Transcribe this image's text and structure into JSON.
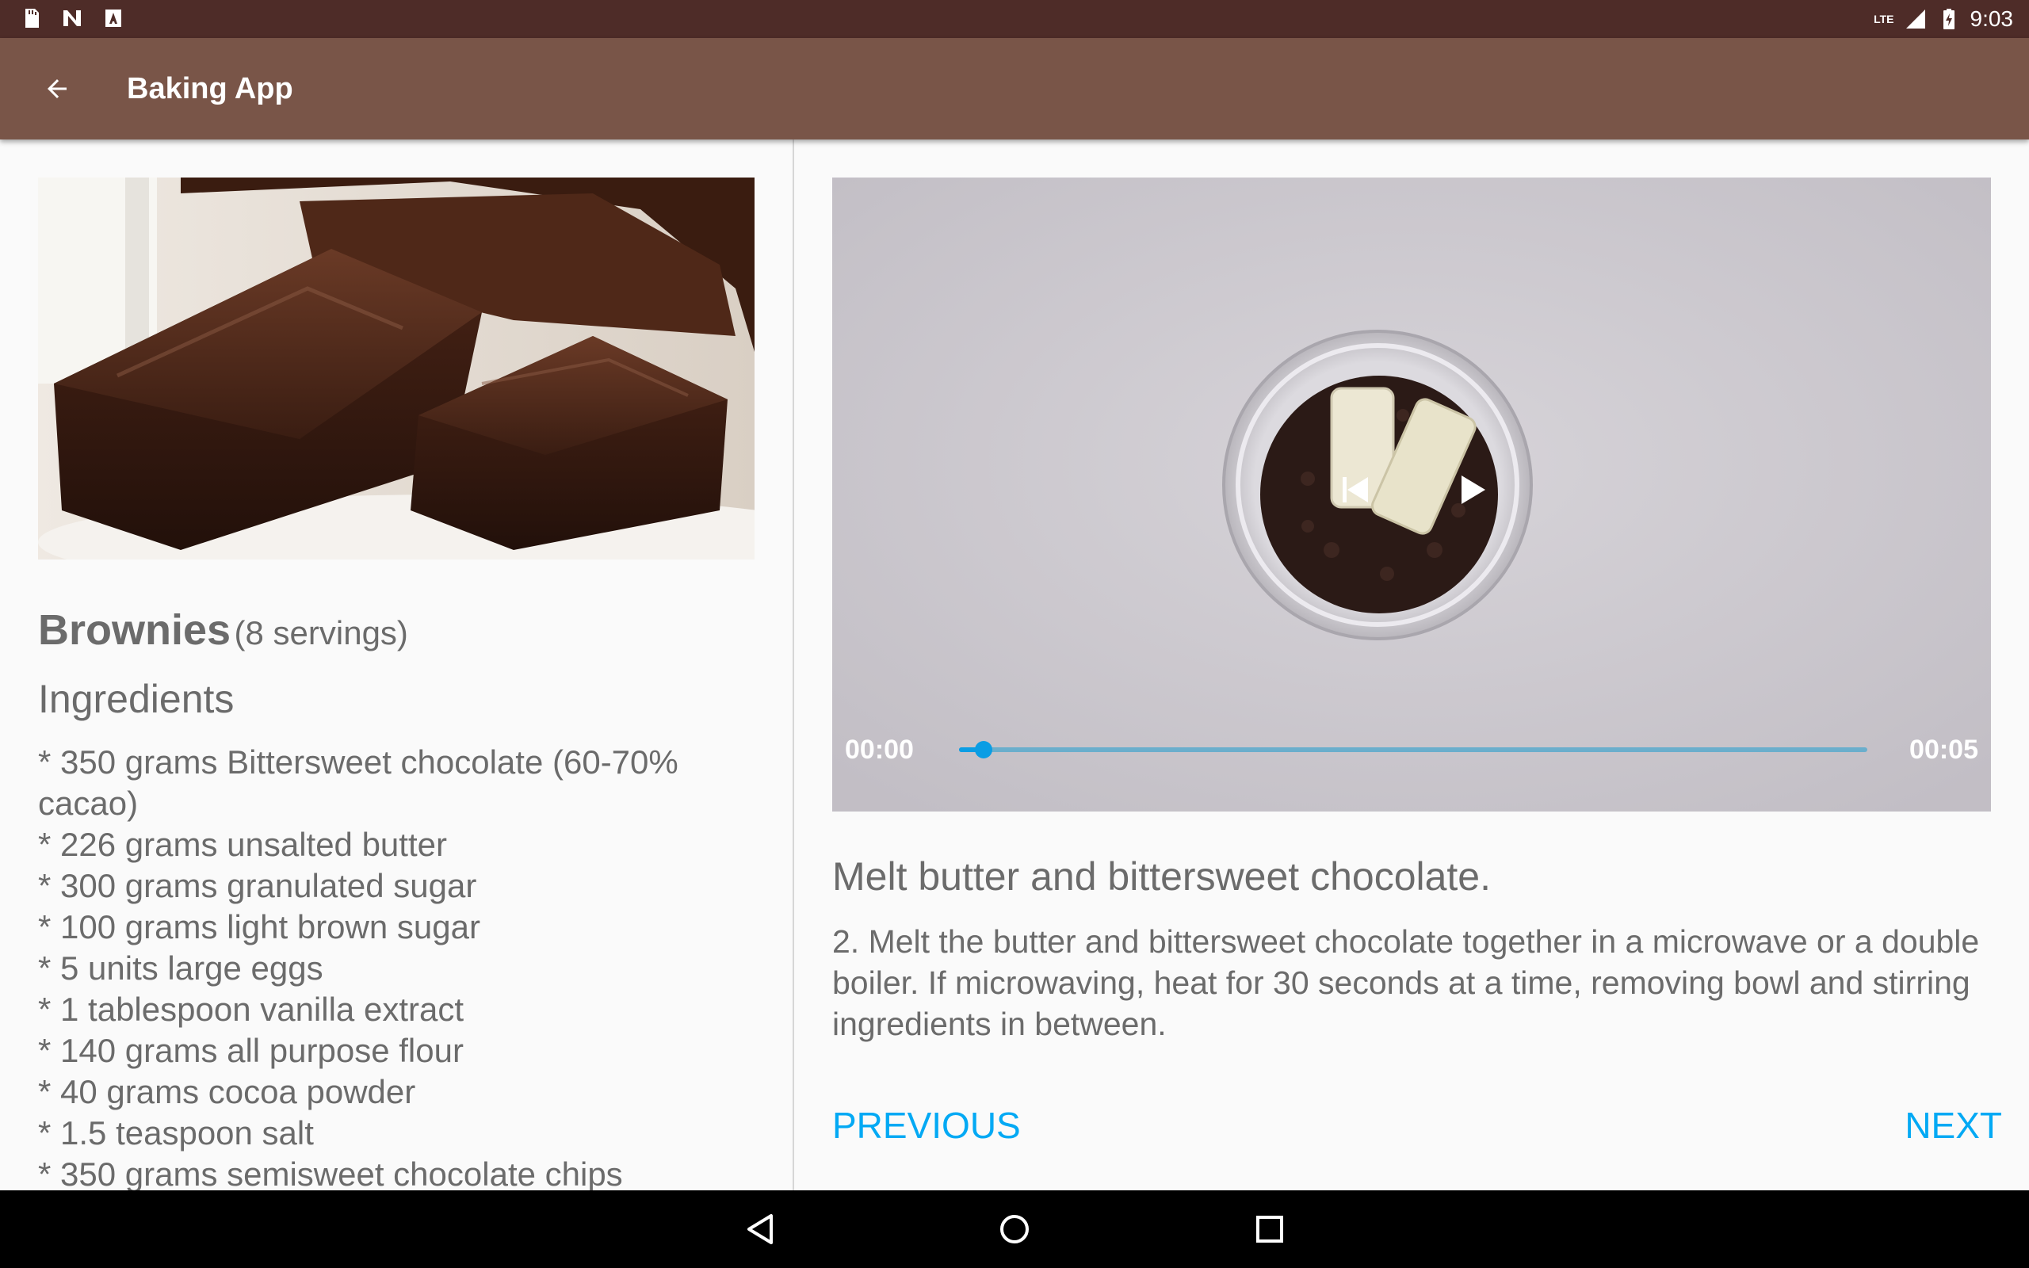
{
  "status_bar": {
    "time": "9:03",
    "network": "LTE",
    "left_icons": [
      "sd-card-icon",
      "n-notification-icon",
      "a-notification-icon"
    ],
    "right_icons": [
      "signal-icon",
      "battery-charging-icon"
    ]
  },
  "app_bar": {
    "title": "Baking App",
    "back_icon": "arrow-back-icon",
    "color": "#795548"
  },
  "recipe": {
    "image": "brownies-photo",
    "name": "Brownies",
    "servings": "(8 servings)",
    "ingredients_title": "Ingredients",
    "ingredients": [
      "* 350 grams Bittersweet chocolate (60-70% cacao)",
      "* 226 grams unsalted butter",
      "* 300 grams granulated sugar",
      "* 100 grams light brown sugar",
      "* 5 units large eggs",
      "* 1 tablespoon vanilla extract",
      "* 140 grams all purpose flour",
      "* 40 grams cocoa powder",
      "* 1.5 teaspoon salt",
      "* 350 grams semisweet chocolate chips"
    ]
  },
  "player": {
    "thumbnail": "bowl-of-chocolate-chips-and-butter",
    "position": "00:00",
    "duration": "00:05",
    "progress": 0.027,
    "controls": [
      "skip-previous-icon",
      "play-icon"
    ],
    "accent": "#0a9de4"
  },
  "step": {
    "short_description": "Melt butter and bittersweet chocolate.",
    "description": "2. Melt the butter and bittersweet chocolate together in a microwave or a double boiler. If microwaving, heat for 30 seconds at a time, removing bowl and stirring ingredients in between."
  },
  "navigation": {
    "previous_label": "PREVIOUS",
    "next_label": "NEXT",
    "color": "#03a9f4"
  },
  "system_nav": [
    "back-triangle-icon",
    "home-circle-icon",
    "recents-square-icon"
  ]
}
